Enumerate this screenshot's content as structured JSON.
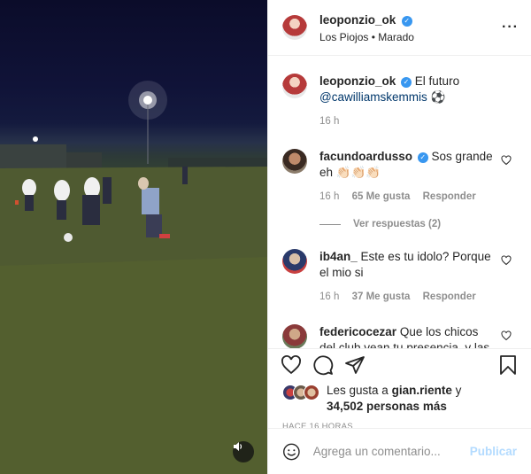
{
  "post": {
    "username": "leoponzio_ok",
    "song": "Los Piojos",
    "song_separator": "•",
    "location": "Marado"
  },
  "caption": {
    "username": "leoponzio_ok",
    "text": "El futuro",
    "mention": "@cawilliamskemmis",
    "emoji": "⚽",
    "time": "16 h"
  },
  "comments": [
    {
      "username": "facundoardusso",
      "text": "Sos grande eh",
      "emoji": "👏🏻👏🏻👏🏻",
      "time": "16 h",
      "likes": "65 Me gusta",
      "reply": "Responder",
      "view_replies": "Ver respuestas (2)"
    },
    {
      "username": "ib4an_",
      "text": "Este es tu idolo? Porque el mio si",
      "time": "16 h",
      "likes": "37 Me gusta",
      "reply": "Responder"
    },
    {
      "username": "federicocezar",
      "text": "Que los chicos del club vean tu presencia, y las"
    }
  ],
  "likes": {
    "prefix": "Les gusta a",
    "user": "gian.riente",
    "conj": "y",
    "count": "34,502 personas más"
  },
  "posted_ago": "HACE 16 HORAS",
  "add_comment": {
    "placeholder": "Agrega un comentario...",
    "publish_label": "Publicar"
  },
  "icons": {
    "more": "more-options-icon",
    "like": "heart-icon",
    "comment": "comment-icon",
    "share": "share-icon",
    "save": "bookmark-icon",
    "emoji": "emoji-icon",
    "mute": "speaker-icon"
  },
  "colors": {
    "verified": "#3897f0",
    "link": "#00376b",
    "publish": "#b3dbff",
    "muted": "#8e8e8e"
  }
}
